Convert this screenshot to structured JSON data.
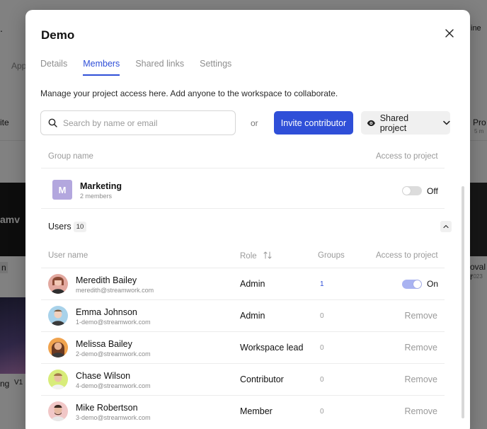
{
  "background": {
    "left_text_1": "App",
    "left_text_2": "ite",
    "left_text_3": "n",
    "left_text_4": "ng",
    "left_text_5": "V1",
    "thumb_text": "amv",
    "right_text_1": "ine",
    "right_text_2": "Pro",
    "right_text_3": "5 m",
    "right_text_4": "oval r",
    "right_text_5": "2023"
  },
  "modal": {
    "title": "Demo",
    "tabs": [
      {
        "label": "Details",
        "active": false
      },
      {
        "label": "Members",
        "active": true
      },
      {
        "label": "Shared links",
        "active": false
      },
      {
        "label": "Settings",
        "active": false
      }
    ],
    "intro": "Manage your project access here. Add anyone to the workspace to collaborate.",
    "search": {
      "placeholder": "Search by name or email",
      "value": ""
    },
    "or_label": "or",
    "invite_label": "Invite contributor",
    "shared_label": "Shared project",
    "groups_table": {
      "col_name": "Group name",
      "col_access": "Access to project",
      "rows": [
        {
          "initial": "M",
          "name": "Marketing",
          "subtitle": "2 members",
          "access": "Off",
          "avatar_color": "#b3a7de"
        }
      ]
    },
    "users": {
      "title": "Users",
      "count": "10",
      "col_name": "User name",
      "col_role": "Role",
      "col_groups": "Groups",
      "col_access": "Access to project",
      "rows": [
        {
          "name": "Meredith Bailey",
          "email": "meredith@streamwork.com",
          "role": "Admin",
          "groups": "1",
          "access": "On"
        },
        {
          "name": "Emma Johnson",
          "email": "1-demo@streamwork.com",
          "role": "Admin",
          "groups": "0",
          "access": "Remove"
        },
        {
          "name": "Melissa Bailey",
          "email": "2-demo@streamwork.com",
          "role": "Workspace lead",
          "groups": "0",
          "access": "Remove"
        },
        {
          "name": "Chase Wilson",
          "email": "4-demo@streamwork.com",
          "role": "Contributor",
          "groups": "0",
          "access": "Remove"
        },
        {
          "name": "Mike Robertson",
          "email": "3-demo@streamwork.com",
          "role": "Member",
          "groups": "0",
          "access": "Remove"
        }
      ]
    }
  },
  "colors": {
    "accent": "#2f4fd8",
    "toggle_on": "#a9b3f1",
    "toggle_off": "#dcdcdc"
  }
}
